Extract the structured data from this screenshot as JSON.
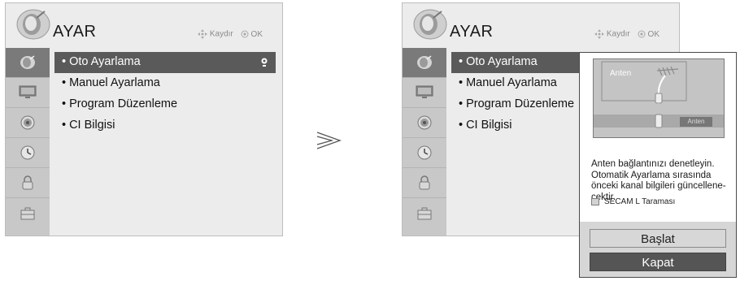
{
  "left_menu": {
    "title": "AYAR",
    "hints": {
      "scroll_label": "Kaydır",
      "ok_label": "OK"
    },
    "items": [
      {
        "label": "Oto Ayarlama"
      },
      {
        "label": "Manuel Ayarlama"
      },
      {
        "label": "Program Düzenleme"
      },
      {
        "label": "CI Bilgisi"
      }
    ]
  },
  "arrow_glyph": "≫",
  "right_menu": {
    "title": "AYAR",
    "hints": {
      "scroll_label": "Kaydır",
      "ok_label": "OK"
    },
    "items": [
      {
        "label": "Oto Ayarlama"
      },
      {
        "label": "Manuel Ayarlama"
      },
      {
        "label": "Program Düzenleme"
      },
      {
        "label": "CI Bilgisi"
      }
    ]
  },
  "popup": {
    "preview_label": "Anten",
    "preview_tag": "Anten",
    "message_lines": [
      "Anten bağlantınızı denetleyin.",
      "Otomatik Ayarlama sırasında",
      "önceki kanal bilgileri güncellene-",
      "cektir."
    ],
    "checkbox_label": "SECAM L Taraması",
    "start_button": "Başlat",
    "close_button": "Kapat"
  },
  "icons": {
    "sidebar": [
      "satellite-icon",
      "monitor-icon",
      "speaker-icon",
      "clock-icon",
      "lock-icon",
      "toolbox-icon"
    ],
    "header": [
      "navigation-arrows-icon",
      "ok-icon"
    ]
  },
  "colors": {
    "menu_bg": "#ececec",
    "sidebar_bg": "#c8c8c8",
    "sidebar_active": "#7a7a7a",
    "selected_item": "#5a5a5a",
    "close_button_bg": "#555555"
  }
}
